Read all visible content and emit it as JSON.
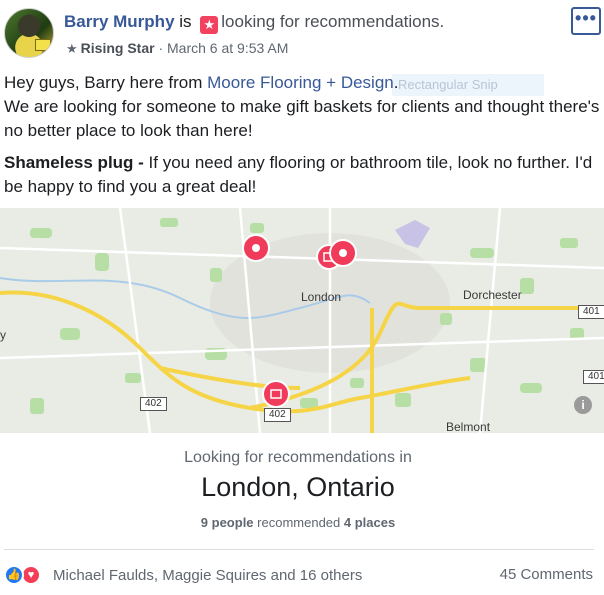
{
  "post": {
    "author": "Barry Murphy",
    "is_text": "is",
    "activity": "looking for recommendations.",
    "badge": "Rising Star",
    "timestamp": "March 6 at 9:53 AM",
    "more_icon": "•••",
    "body_line1_before": "Hey guys, Barry here from ",
    "body_link": "Moore Flooring + Design",
    "body_line1_after": ".",
    "body_line2": "We are looking for someone to make gift baskets for clients and thought there's no better place to look than here!",
    "body_bold": "Shameless plug -",
    "body_line3": " If you need any flooring or bathroom tile, look no further. I'd be happy to find you a great deal!",
    "snip_ghost": "Rectangular Snip"
  },
  "map": {
    "labels": {
      "london": "London",
      "dorchester": "Dorchester",
      "belmont": "Belmont",
      "edge": "y"
    },
    "highways": {
      "h401_right": "401",
      "h401_edge": "401",
      "h402_left": "402",
      "h402_mid": "402"
    },
    "info_icon": "i",
    "colors": {
      "pin": "#f03c5a",
      "highway": "#f5d547",
      "land": "#e9ece4",
      "parks": "#b7dfa5"
    }
  },
  "recommendation": {
    "title": "Looking for recommendations in",
    "location": "London, Ontario",
    "people_count": "9 people",
    "recommended_text": " recommended ",
    "places_count": "4 places"
  },
  "footer": {
    "reactors": "Michael Faulds, Maggie Squires and 16 others",
    "comments": "45 Comments",
    "like_icon": "👍",
    "love_icon": "♥"
  }
}
